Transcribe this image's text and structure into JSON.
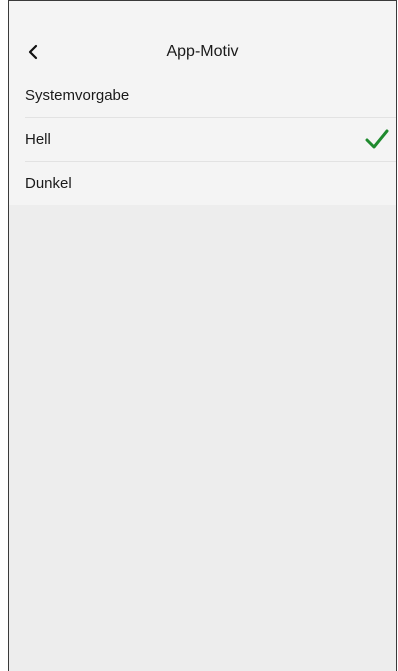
{
  "header": {
    "back_icon": "chevron-left-icon",
    "title": "App-Motiv"
  },
  "theme_options": [
    {
      "label": "Systemvorgabe",
      "selected": false
    },
    {
      "label": "Hell",
      "selected": true
    },
    {
      "label": "Dunkel",
      "selected": false
    }
  ],
  "colors": {
    "check": "#1f8a2e",
    "background": "#ededed",
    "surface": "#f4f4f4"
  },
  "icons": {
    "selected": "checkmark-icon"
  }
}
